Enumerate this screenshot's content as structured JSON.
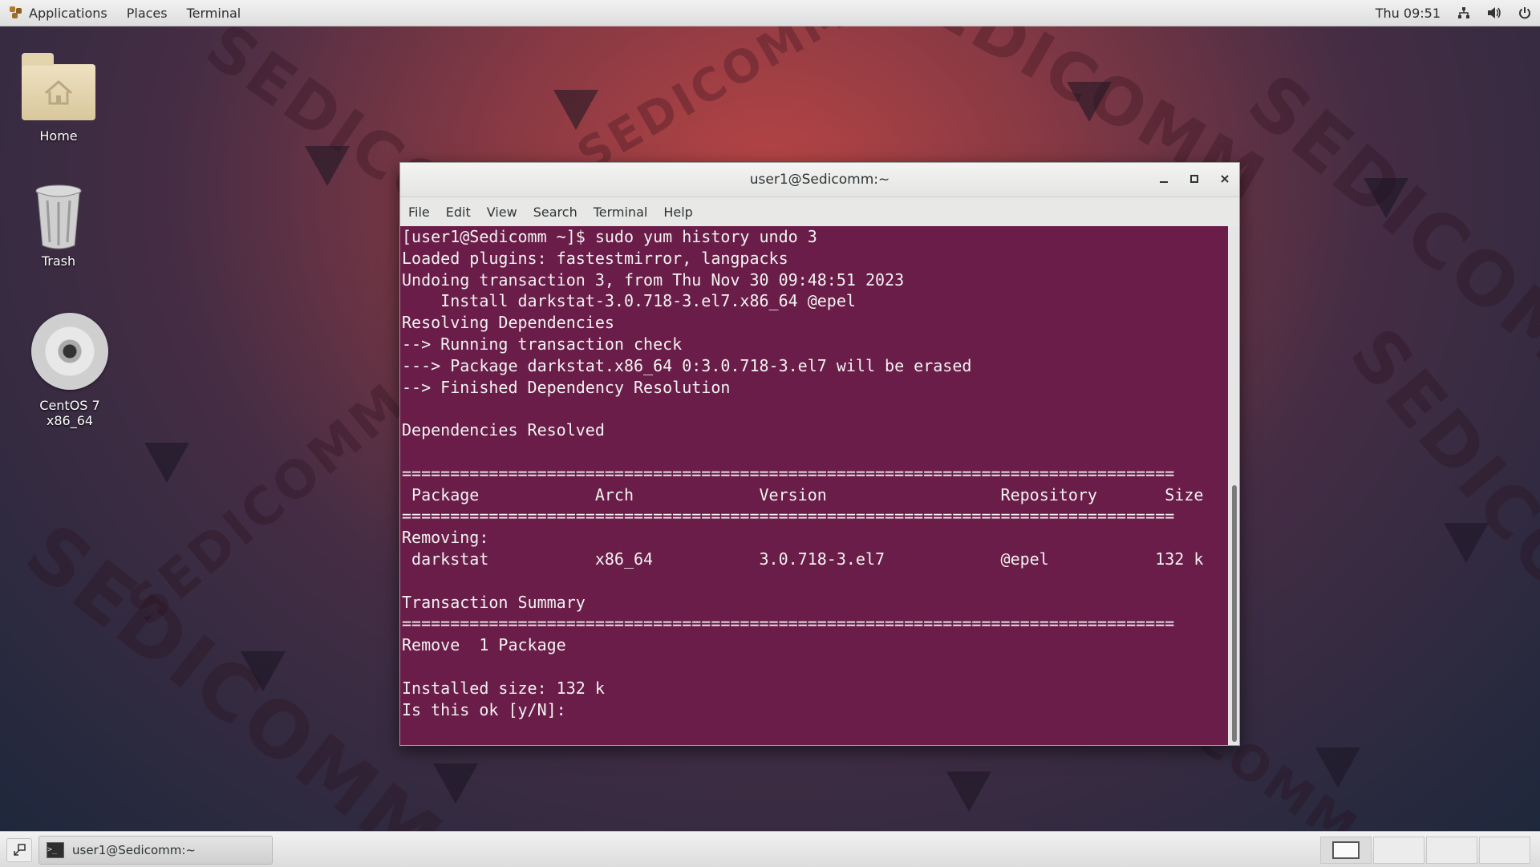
{
  "top_panel": {
    "applications": "Applications",
    "places": "Places",
    "terminal": "Terminal",
    "clock": "Thu 09:51",
    "icons": [
      "network-icon",
      "volume-icon",
      "power-icon"
    ]
  },
  "desktop": {
    "watermark": "SEDICOMM",
    "icons": [
      {
        "label": "Home",
        "icon": "home-folder-icon"
      },
      {
        "label": "Trash",
        "icon": "trash-icon"
      },
      {
        "label": "CentOS 7 x86_64",
        "icon": "disc-icon"
      }
    ]
  },
  "terminal_window": {
    "title": "user1@Sedicomm:~",
    "menu": [
      "File",
      "Edit",
      "View",
      "Search",
      "Terminal",
      "Help"
    ],
    "lines": [
      "[user1@Sedicomm ~]$ sudo yum history undo 3",
      "Loaded plugins: fastestmirror, langpacks",
      "Undoing transaction 3, from Thu Nov 30 09:48:51 2023",
      "    Install darkstat-3.0.718-3.el7.x86_64 @epel",
      "Resolving Dependencies",
      "--> Running transaction check",
      "---> Package darkstat.x86_64 0:3.0.718-3.el7 will be erased",
      "--> Finished Dependency Resolution",
      "",
      "Dependencies Resolved",
      "",
      "================================================================================",
      " Package            Arch             Version                  Repository       Size",
      "================================================================================",
      "Removing:",
      " darkstat           x86_64           3.0.718-3.el7            @epel           132 k",
      "",
      "Transaction Summary",
      "================================================================================",
      "Remove  1 Package",
      "",
      "Installed size: 132 k",
      "Is this ok [y/N]: "
    ]
  },
  "bottom_panel": {
    "task_label": "user1@Sedicomm:~"
  },
  "colors": {
    "terminal_bg": "#6a1d48",
    "terminal_fg": "#f2f2f2"
  }
}
